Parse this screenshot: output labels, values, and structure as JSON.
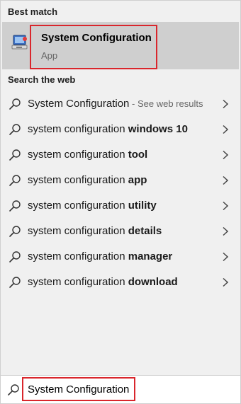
{
  "best_match": {
    "header": "Best match",
    "title": "System Configuration",
    "subtitle": "App",
    "icon": "system-configuration-app-icon"
  },
  "web": {
    "header": "Search the web",
    "items": [
      {
        "prefix": "System Configuration",
        "bold": "",
        "suffix": " - See web results"
      },
      {
        "prefix": "system configuration ",
        "bold": "windows 10",
        "suffix": ""
      },
      {
        "prefix": "system configuration ",
        "bold": "tool",
        "suffix": ""
      },
      {
        "prefix": "system configuration ",
        "bold": "app",
        "suffix": ""
      },
      {
        "prefix": "system configuration ",
        "bold": "utility",
        "suffix": ""
      },
      {
        "prefix": "system configuration ",
        "bold": "details",
        "suffix": ""
      },
      {
        "prefix": "system configuration ",
        "bold": "manager",
        "suffix": ""
      },
      {
        "prefix": "system configuration ",
        "bold": "download",
        "suffix": ""
      }
    ]
  },
  "search": {
    "value": "System Configuration",
    "icon": "search-icon"
  },
  "colors": {
    "highlight_border": "#d9262c",
    "best_match_bg": "#cfcfcf",
    "panel_bg": "#f0f0f0"
  }
}
